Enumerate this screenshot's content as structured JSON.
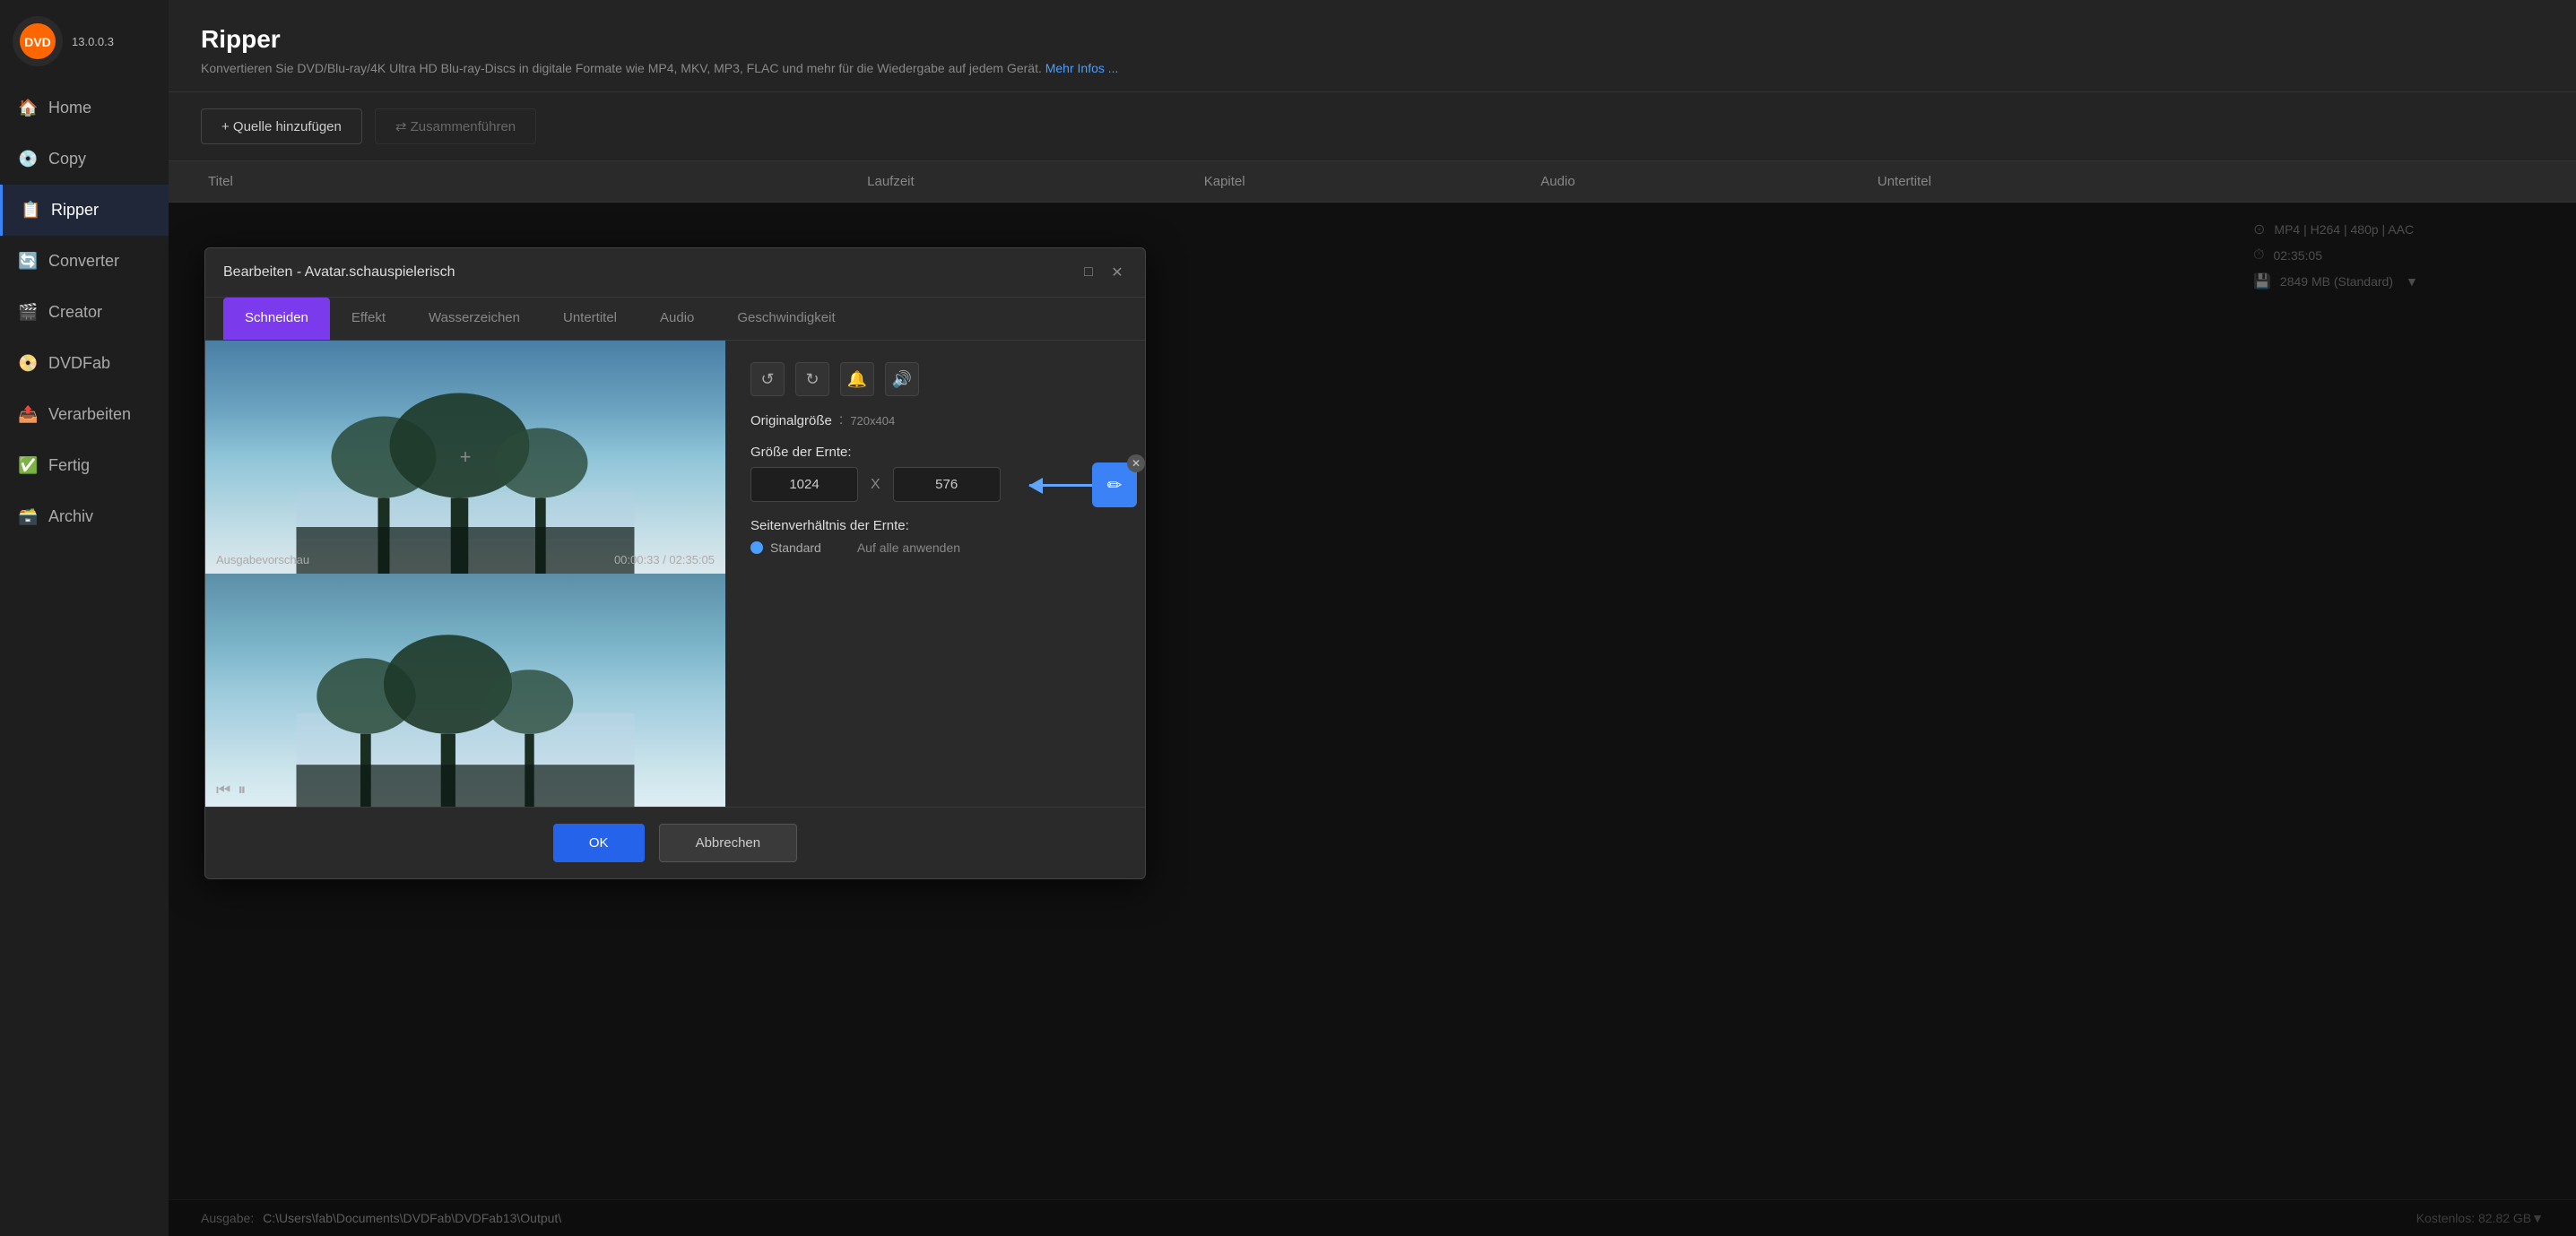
{
  "app": {
    "name": "DVDFab",
    "version": "13.0.0.3"
  },
  "sidebar": {
    "items": [
      {
        "id": "home",
        "label": "Home",
        "icon": "🏠",
        "active": false
      },
      {
        "id": "copy",
        "label": "Copy",
        "icon": "💿",
        "active": false
      },
      {
        "id": "ripper",
        "label": "Ripper",
        "icon": "📋",
        "active": true
      },
      {
        "id": "converter",
        "label": "Converter",
        "icon": "🔄",
        "active": false
      },
      {
        "id": "creator",
        "label": "Creator",
        "icon": "🎬",
        "active": false
      },
      {
        "id": "dvdfab",
        "label": "DVDFab",
        "icon": "📀",
        "active": false
      },
      {
        "id": "verarbeiten",
        "label": "Verarbeiten",
        "icon": "📤",
        "active": false
      },
      {
        "id": "fertig",
        "label": "Fertig",
        "icon": "✅",
        "active": false
      },
      {
        "id": "archiv",
        "label": "Archiv",
        "icon": "🗃️",
        "active": false
      }
    ]
  },
  "main": {
    "title": "Ripper",
    "subtitle": "Konvertieren Sie DVD/Blu-ray/4K Ultra HD Blu-ray-Discs in digitale Formate wie MP4, MKV, MP3, FLAC und mehr für die Wiedergabe auf jedem Gerät.",
    "more_info_link": "Mehr Infos ...",
    "toolbar": {
      "add_source_label": "+ Quelle hinzufügen",
      "zusammenfuhren_label": "⇄ Zusammenführen"
    },
    "table_columns": {
      "titel": "Titel",
      "laufzeit": "Laufzeit",
      "kapitel": "Kapitel",
      "audio": "Audio",
      "untertitel": "Untertitel"
    }
  },
  "dialog": {
    "title": "Bearbeiten - Avatar.schauspielerisch",
    "tabs": [
      {
        "id": "schneiden",
        "label": "Schneiden",
        "active": true
      },
      {
        "id": "effekt",
        "label": "Effekt",
        "active": false
      },
      {
        "id": "wasserzeichen",
        "label": "Wasserzeichen",
        "active": false
      },
      {
        "id": "untertitel",
        "label": "Untertitel",
        "active": false
      },
      {
        "id": "audio",
        "label": "Audio",
        "active": false
      },
      {
        "id": "geschwindigkeit",
        "label": "Geschwindigkeit",
        "active": false
      }
    ],
    "preview": {
      "label": "Ausgabevorschau",
      "time": "00:00:33 / 02:35:05"
    },
    "crop": {
      "original_size_label": "Originalgröße",
      "original_size_value": "720x404",
      "crop_size_label": "Größe der Ernte:",
      "crop_width": "1024",
      "crop_height": "576",
      "x_separator": "X",
      "aspect_ratio_label": "Seitenverhältnis der Ernte:",
      "standard_option": "Standard",
      "apply_all_label": "Auf alle anwenden"
    },
    "footer": {
      "ok_label": "OK",
      "cancel_label": "Abbrechen"
    }
  },
  "right_panel": {
    "format_info": "MP4 | H264 | 480p | AAC",
    "duration": "02:35:05",
    "size": "2849 MB (Standard)"
  },
  "bottom_bar": {
    "ausgabe_label": "Ausgabe:",
    "output_path": "C:\\Users\\fab\\Documents\\DVDFab\\DVDFab13\\Output\\",
    "free_space": "Kostenlos: 82.82 GB▼"
  },
  "icons": {
    "undo": "↺",
    "redo": "↻",
    "bell": "🔔",
    "volume": "🔊",
    "edit": "✏️",
    "close": "✕",
    "maximize": "□",
    "play": "⏸",
    "prev": "⏮",
    "arrow_left": "←"
  }
}
